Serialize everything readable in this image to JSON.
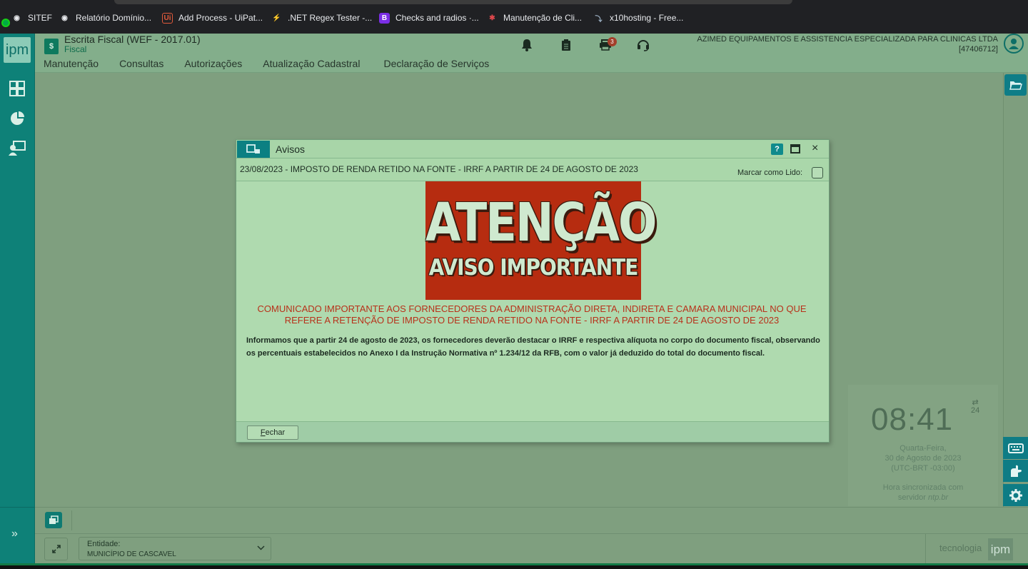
{
  "bookmarks": [
    {
      "label": "SITEF",
      "icon": "globe-icon"
    },
    {
      "label": "Relatório Domínio...",
      "icon": "globe-icon"
    },
    {
      "label": "Add Process - UiPat...",
      "icon": "uipath-icon"
    },
    {
      "label": ".NET Regex Tester -...",
      "icon": "lightning-icon"
    },
    {
      "label": "Checks and radios ·...",
      "icon": "bootstrap-icon"
    },
    {
      "label": "Manutenção de Cli...",
      "icon": "bug-icon"
    },
    {
      "label": "x10hosting - Free...",
      "icon": "bird-icon"
    }
  ],
  "sidebar": {
    "logo": "ipm",
    "icons": [
      "calculator-icon",
      "pie-chart-icon",
      "user-monitor-icon"
    ],
    "expand": "»"
  },
  "header": {
    "app_title": "Escrita Fiscal (WEF - 2017.01)",
    "module": "Fiscal",
    "notifications_badge": "3",
    "company_name": "AZIMED EQUIPAMENTOS E ASSISTENCIA ESPECIALIZADA PARA CLINICAS LTDA",
    "company_code": "[47406712]"
  },
  "menu": [
    "Manutenção",
    "Consultas",
    "Autorizações",
    "Atualização Cadastral",
    "Declaração de Serviços"
  ],
  "dialog": {
    "title": "Avisos",
    "help": "?",
    "close": "×",
    "notice_title": "23/08/2023 - IMPOSTO DE RENDA RETIDO NA FONTE - IRRF A PARTIR DE 24 DE AGOSTO DE 2023",
    "mark_read_label": "Marcar como Lido:",
    "mark_read_checked": false,
    "banner_big": "ATENÇÃO",
    "banner_small": "AVISO IMPORTANTE",
    "red_message": "COMUNICADO IMPORTANTE AOS FORNECEDORES DA ADMINISTRAÇÃO DIRETA, INDIRETA E CAMARA MUNICIPAL NO QUE REFERE A RETENÇÃO DE IMPOSTO DE RENDA RETIDO NA FONTE - IRRF A PARTIR DE 24 DE AGOSTO DE 2023",
    "body_message": "Informamos que a partir 24 de agosto de 2023, os fornecedores deverão destacar o IRRF e respectiva alíquota no corpo do documento fiscal, observando os percentuais estabelecidos no Anexo I da Instrução Normativa nº 1.234/12 da RFB, com o valor já deduzido do total do documento fiscal.",
    "close_button_label_first": "F",
    "close_button_label_rest": "echar"
  },
  "clock": {
    "time": "08:41",
    "format": "24",
    "day": "Quarta-Feira,",
    "date": "30 de Agosto de 2023",
    "timezone": "(UTC-BRT -03:00)",
    "sync_line1": "Hora sincronizada com",
    "sync_line2_prefix": "servidor ",
    "sync_server": "ntp.br"
  },
  "footer": {
    "entity_label": "Entidade:",
    "entity_value": "MUNICÍPIO DE CASCAVEL",
    "brand_text": "tecnologia",
    "brand_logo": "ipm"
  },
  "colors": {
    "sidebar": "#0e8178",
    "workspace": "#7f9f7f",
    "dialog_bg": "#afdaaf",
    "banner_red": "#b62c10",
    "notice_red": "#b8311a"
  }
}
